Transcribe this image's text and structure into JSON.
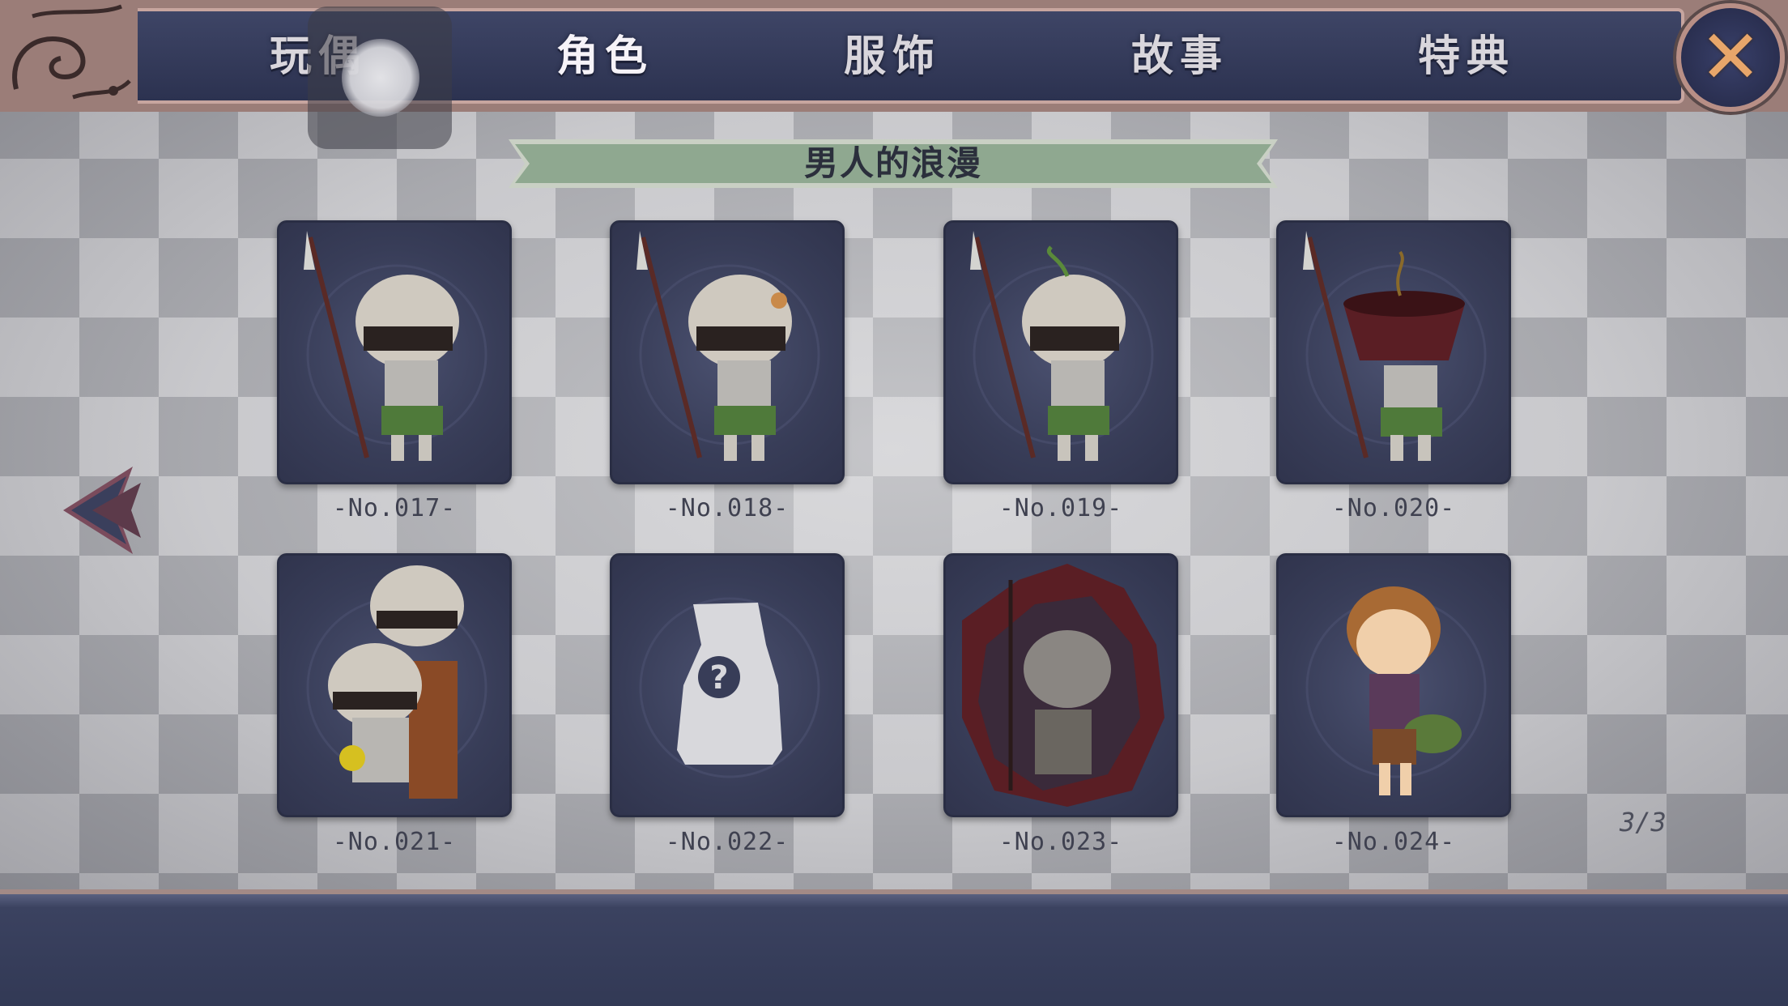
{
  "tabs": [
    {
      "label": "玩偶"
    },
    {
      "label": "角色"
    },
    {
      "label": "服饰"
    },
    {
      "label": "故事"
    },
    {
      "label": "特典"
    }
  ],
  "active_tab": "角色",
  "close_icon": "close-icon",
  "banner": {
    "title": "男人的浪漫"
  },
  "cards": [
    {
      "label": "-No.017-",
      "icon": "spear-knight-figure"
    },
    {
      "label": "-No.018-",
      "icon": "spear-knight-figure"
    },
    {
      "label": "-No.019-",
      "icon": "spear-knight-sprout-figure"
    },
    {
      "label": "-No.020-",
      "icon": "spear-knight-pot-figure"
    },
    {
      "label": "-No.021-",
      "icon": "two-knights-chair-figure"
    },
    {
      "label": "-No.022-",
      "icon": "locked-unknown-figure"
    },
    {
      "label": "-No.023-",
      "icon": "shattered-knight-figure"
    },
    {
      "label": "-No.024-",
      "icon": "boy-with-bag-figure"
    }
  ],
  "page": {
    "indicator": "3/3"
  },
  "colors": {
    "nav_bg": "#2c3250",
    "frame": "#c7a59f",
    "card_bg": "#383d58",
    "banner_green": "#8fa890",
    "close_accent": "#e8a66a"
  }
}
